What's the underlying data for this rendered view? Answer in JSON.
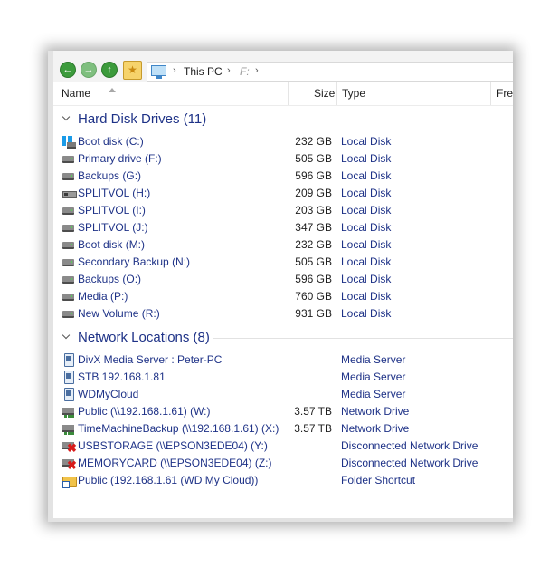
{
  "address": {
    "location": "This PC",
    "sub": "F:"
  },
  "columns": {
    "name": "Name",
    "size": "Size",
    "type": "Type",
    "free": "Fre"
  },
  "groups": [
    {
      "title": "Hard Disk Drives (11)",
      "items": [
        {
          "icon": "windows-drive-icon",
          "name": "Boot disk (C:)",
          "size": "232 GB",
          "type": "Local Disk"
        },
        {
          "icon": "hard-drive-icon",
          "name": "Primary drive (F:)",
          "size": "505 GB",
          "type": "Local Disk"
        },
        {
          "icon": "hard-drive-icon",
          "name": "Backups (G:)",
          "size": "596 GB",
          "type": "Local Disk"
        },
        {
          "icon": "split-volume-icon",
          "name": "SPLITVOL (H:)",
          "size": "209 GB",
          "type": "Local Disk"
        },
        {
          "icon": "hard-drive-icon",
          "name": "SPLITVOL (I:)",
          "size": "203 GB",
          "type": "Local Disk"
        },
        {
          "icon": "hard-drive-icon",
          "name": "SPLITVOL (J:)",
          "size": "347 GB",
          "type": "Local Disk"
        },
        {
          "icon": "hard-drive-icon",
          "name": "Boot disk (M:)",
          "size": "232 GB",
          "type": "Local Disk"
        },
        {
          "icon": "hard-drive-icon",
          "name": "Secondary Backup (N:)",
          "size": "505 GB",
          "type": "Local Disk"
        },
        {
          "icon": "hard-drive-icon",
          "name": "Backups (O:)",
          "size": "596 GB",
          "type": "Local Disk"
        },
        {
          "icon": "hard-drive-icon",
          "name": "Media (P:)",
          "size": "760 GB",
          "type": "Local Disk"
        },
        {
          "icon": "hard-drive-icon",
          "name": "New Volume (R:)",
          "size": "931 GB",
          "type": "Local Disk"
        }
      ]
    },
    {
      "title": "Network Locations (8)",
      "items": [
        {
          "icon": "media-server-icon",
          "name": "DivX Media Server : Peter-PC",
          "size": "",
          "type": "Media Server"
        },
        {
          "icon": "media-server-icon",
          "name": "STB 192.168.1.81",
          "size": "",
          "type": "Media Server"
        },
        {
          "icon": "media-server-icon",
          "name": "WDMyCloud",
          "size": "",
          "type": "Media Server"
        },
        {
          "icon": "network-drive-icon",
          "name": "Public (\\\\192.168.1.61) (W:)",
          "size": "3.57 TB",
          "type": "Network Drive"
        },
        {
          "icon": "network-drive-icon",
          "name": "TimeMachineBackup (\\\\192.168.1.61) (X:)",
          "size": "3.57 TB",
          "type": "Network Drive"
        },
        {
          "icon": "disconnected-drive-icon",
          "name": "USBSTORAGE (\\\\EPSON3EDE04) (Y:)",
          "size": "",
          "type": "Disconnected Network Drive"
        },
        {
          "icon": "disconnected-drive-icon",
          "name": "MEMORYCARD (\\\\EPSON3EDE04) (Z:)",
          "size": "",
          "type": "Disconnected Network Drive"
        },
        {
          "icon": "folder-shortcut-icon",
          "name": "Public (192.168.1.61 (WD My Cloud))",
          "size": "",
          "type": "Folder Shortcut"
        }
      ]
    }
  ]
}
